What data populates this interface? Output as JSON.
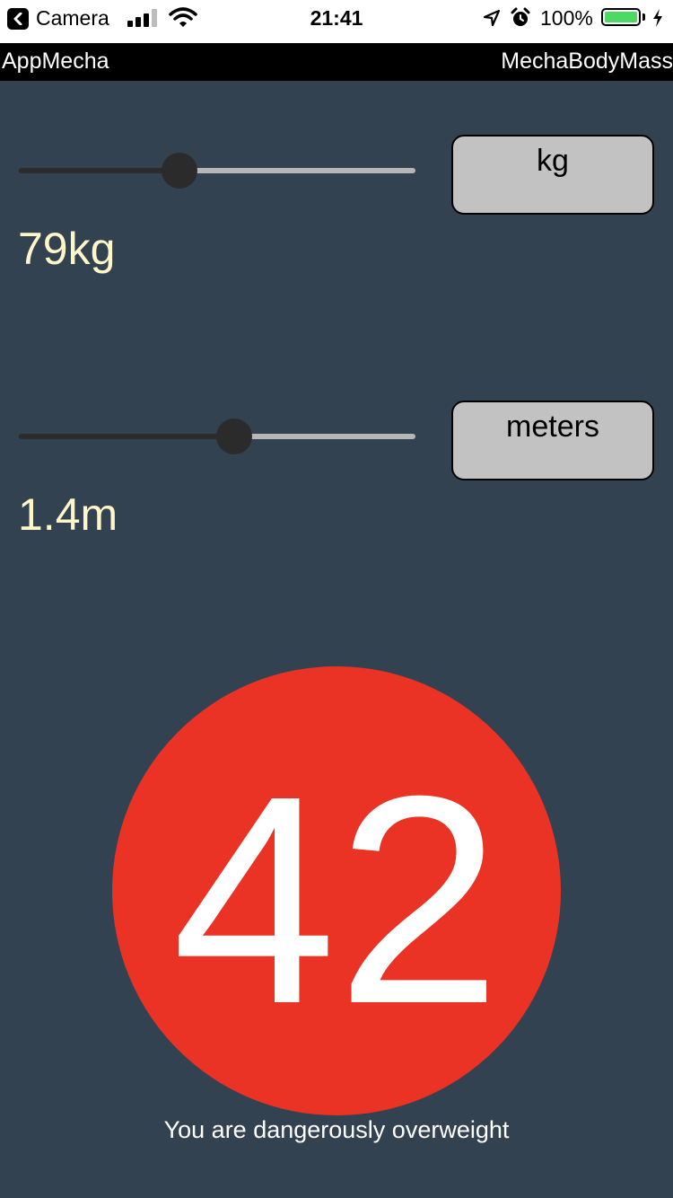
{
  "status_bar": {
    "back_label": "Camera",
    "time": "21:41",
    "battery_percent": "100%",
    "signal_bars": 3,
    "signal_bars_total": 4,
    "battery_level": 1.0,
    "battery_color": "#4cd964",
    "icons": [
      "chevron-left-icon",
      "cellular-signal-icon",
      "wifi-icon",
      "location-arrow-icon",
      "alarm-icon",
      "battery-icon",
      "charging-bolt-icon"
    ]
  },
  "nav_bar": {
    "left_title": "AppMecha",
    "right_title": "MechaBodyMass"
  },
  "weight": {
    "value_label": "79kg",
    "unit_button": "kg",
    "slider_fraction": 0.406
  },
  "height": {
    "value_label": "1.4m",
    "unit_button": "meters",
    "slider_fraction": 0.544
  },
  "bmi": {
    "value": "42",
    "message": "You are dangerously overweight",
    "color": "#ea3324"
  },
  "colors": {
    "background": "#334251",
    "value_text": "#fdf6c8",
    "button_bg": "#c2c2c2"
  }
}
